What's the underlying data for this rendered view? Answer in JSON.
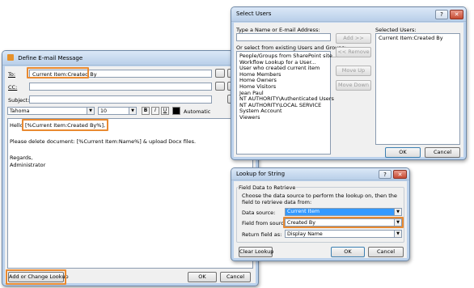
{
  "email_dialog": {
    "title": "Define E-mail Message",
    "help_button": "?",
    "to_label": "To:",
    "to_value": "Current Item:Created By",
    "cc_label": "CC:",
    "subject_label": "Subject:",
    "font_name": "Tahoma",
    "font_size": "10",
    "bold": "B",
    "italic": "I",
    "underline": "U",
    "color_label": "Automatic",
    "body_hello": "Hello",
    "body_token": "[%Current Item:Created By%],",
    "body_line2": "Please delete document: [%Current Item:Name%] & upload Docx files.",
    "body_line3": "Regards,",
    "body_line4": "Administrator",
    "lookup_button": "Add or Change Lookup",
    "ok_button": "OK",
    "cancel_button": "Cancel"
  },
  "select_users": {
    "title": "Select Users",
    "help_button": "?",
    "name_label": "Type a Name or E-mail Address:",
    "existing_label": "Or select from existing Users and Groups:",
    "users_list": [
      "People/Groups from SharePoint site...",
      "Workflow Lookup for a User...",
      "User who created current item",
      "Home Members",
      "Home Owners",
      "Home Visitors",
      "Jean Paul",
      "NT AUTHORITY\\Authenticated Users",
      "NT AUTHORITY\\LOCAL SERVICE",
      "System Account",
      "Viewers"
    ],
    "add_button": "Add >>",
    "remove_button": "<< Remove",
    "move_up_button": "Move Up",
    "move_down_button": "Move Down",
    "selected_label": "Selected Users:",
    "selected_list": [
      "Current Item:Created By"
    ],
    "ok_button": "OK",
    "cancel_button": "Cancel"
  },
  "lookup_dialog": {
    "title": "Lookup for String",
    "help_button": "?",
    "group_label": "Field Data to Retrieve",
    "description": "Choose the data source to perform the lookup on, then the field to retrieve data from:",
    "data_source_label": "Data source:",
    "data_source_value": "Current Item",
    "field_label": "Field from source:",
    "field_value": "Created By",
    "return_label": "Return field as:",
    "return_value": "Display Name",
    "clear_button": "Clear Lookup",
    "ok_button": "OK",
    "cancel_button": "Cancel"
  },
  "colors": {
    "highlight": "#e98a31",
    "selection": "#3399ff",
    "title_bar": "#bcd2ec"
  }
}
